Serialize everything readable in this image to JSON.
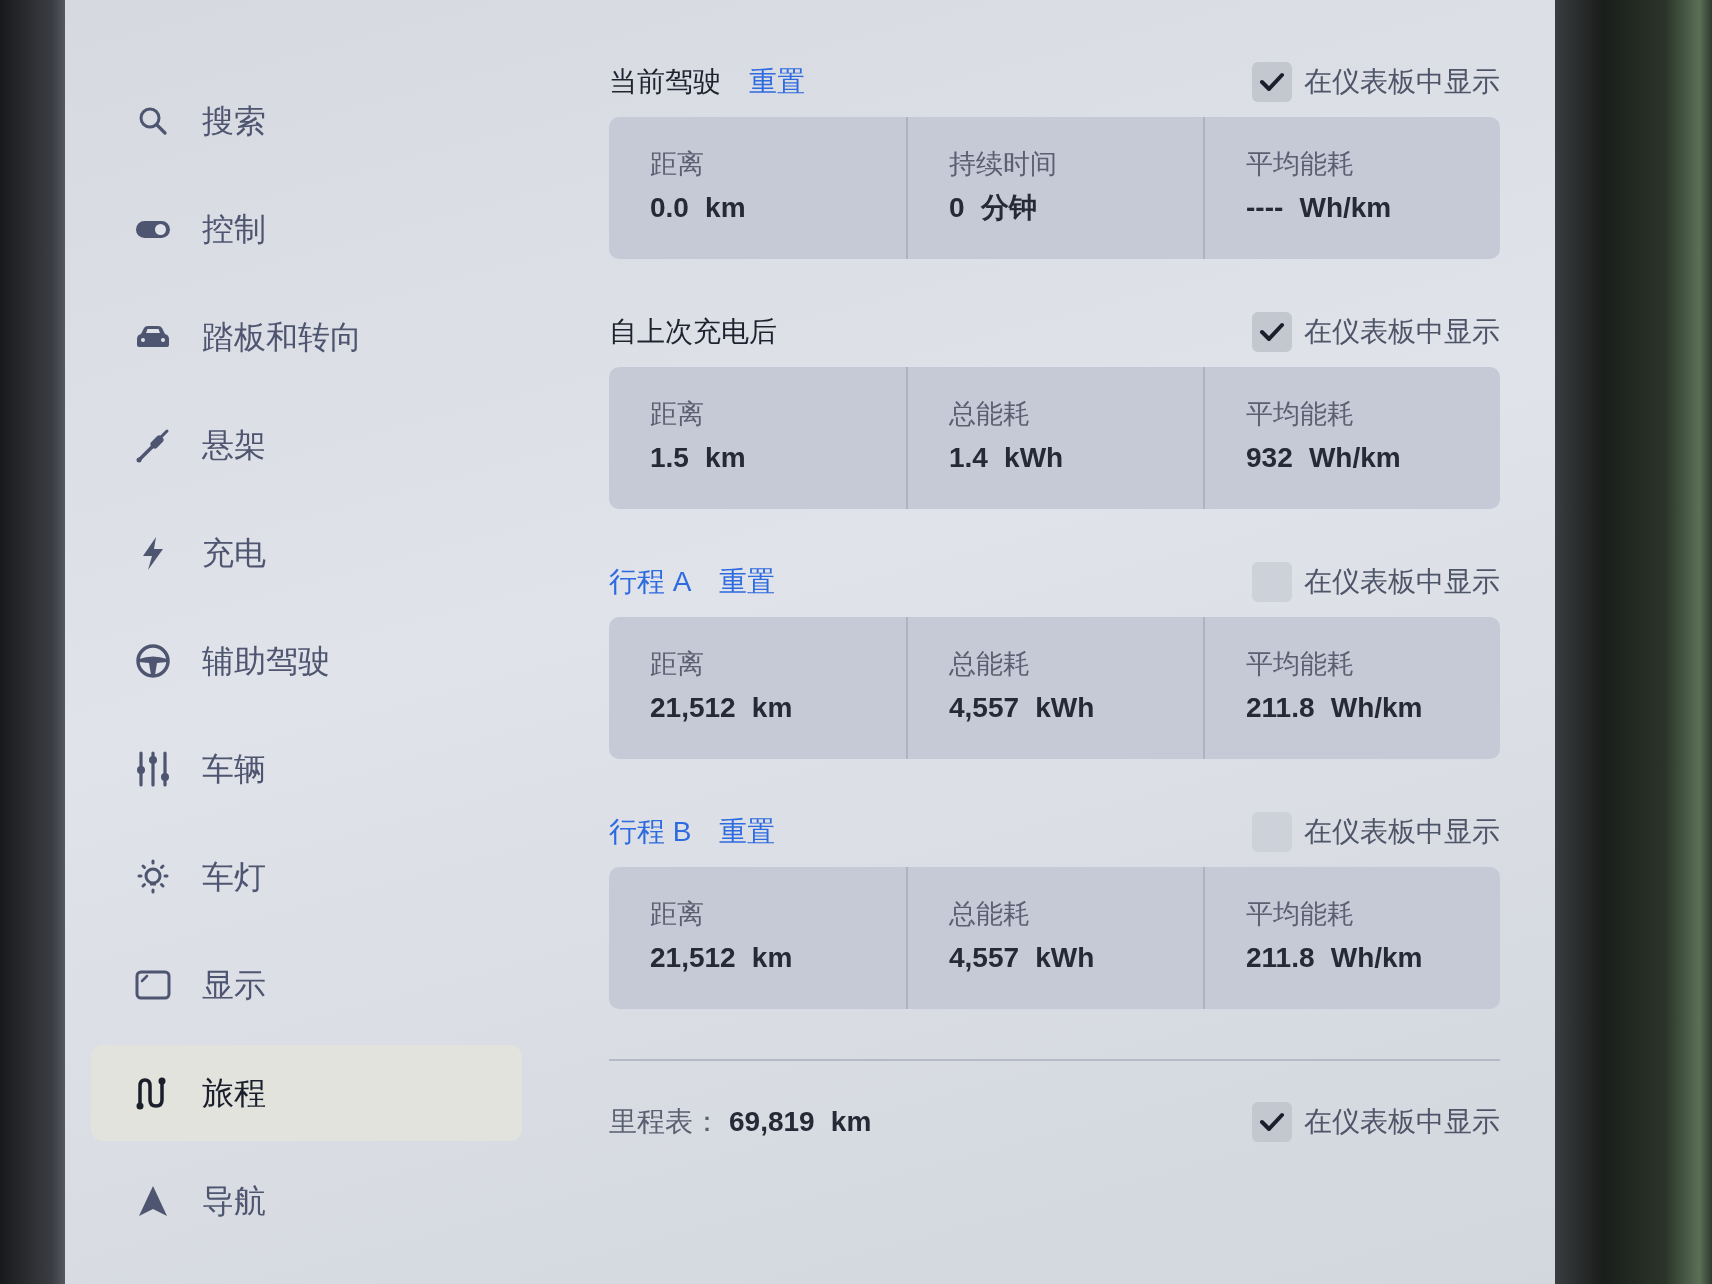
{
  "sidebar": {
    "items": [
      {
        "label": "搜索",
        "selected": false
      },
      {
        "label": "控制",
        "selected": false
      },
      {
        "label": "踏板和转向",
        "selected": false
      },
      {
        "label": "悬架",
        "selected": false
      },
      {
        "label": "充电",
        "selected": false
      },
      {
        "label": "辅助驾驶",
        "selected": false
      },
      {
        "label": "车辆",
        "selected": false
      },
      {
        "label": "车灯",
        "selected": false
      },
      {
        "label": "显示",
        "selected": false
      },
      {
        "label": "旅程",
        "selected": true
      },
      {
        "label": "导航",
        "selected": false
      }
    ]
  },
  "sections": [
    {
      "title": "当前驾驶",
      "title_link": false,
      "reset": "重置",
      "dashboard_toggle": {
        "label": "在仪表板中显示",
        "checked": true
      },
      "stats": [
        {
          "label": "距离",
          "value": "0.0 km"
        },
        {
          "label": "持续时间",
          "value": "0 分钟"
        },
        {
          "label": "平均能耗",
          "value": "---- Wh/km"
        }
      ]
    },
    {
      "title": "自上次充电后",
      "title_link": false,
      "dashboard_toggle": {
        "label": "在仪表板中显示",
        "checked": true
      },
      "stats": [
        {
          "label": "距离",
          "value": "1.5 km"
        },
        {
          "label": "总能耗",
          "value": "1.4 kWh"
        },
        {
          "label": "平均能耗",
          "value": "932 Wh/km"
        }
      ]
    },
    {
      "title": "行程 A",
      "title_link": true,
      "reset": "重置",
      "dashboard_toggle": {
        "label": "在仪表板中显示",
        "checked": false
      },
      "stats": [
        {
          "label": "距离",
          "value": "21,512 km"
        },
        {
          "label": "总能耗",
          "value": "4,557 kWh"
        },
        {
          "label": "平均能耗",
          "value": "211.8 Wh/km"
        }
      ]
    },
    {
      "title": "行程 B",
      "title_link": true,
      "reset": "重置",
      "dashboard_toggle": {
        "label": "在仪表板中显示",
        "checked": false
      },
      "stats": [
        {
          "label": "距离",
          "value": "21,512 km"
        },
        {
          "label": "总能耗",
          "value": "4,557 kWh"
        },
        {
          "label": "平均能耗",
          "value": "211.8 Wh/km"
        }
      ]
    }
  ],
  "odometer": {
    "label": "里程表：",
    "value": "69,819 km",
    "dashboard_toggle": {
      "label": "在仪表板中显示",
      "checked": true
    }
  }
}
